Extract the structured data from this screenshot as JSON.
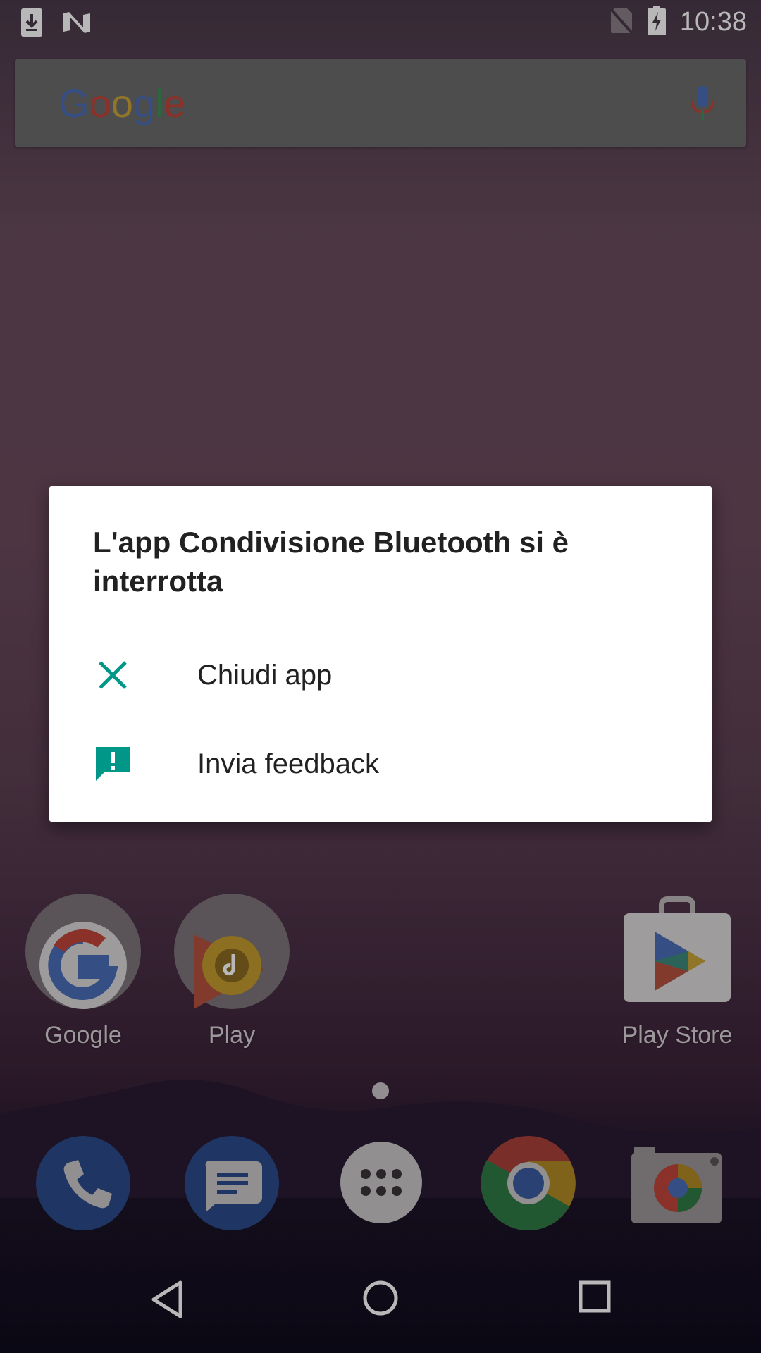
{
  "status_bar": {
    "time": "10:38",
    "left_icons": [
      "download-icon",
      "n-logo-icon"
    ],
    "right_icons": [
      "no-sim-icon",
      "battery-charging-icon"
    ]
  },
  "search": {
    "logo_text": "Google",
    "mic_icon": "mic-icon"
  },
  "apps": [
    {
      "label": "Google",
      "icon": "google-folder-icon"
    },
    {
      "label": "Play",
      "icon": "play-folder-icon"
    },
    {
      "label": "Play Store",
      "icon": "play-store-icon"
    }
  ],
  "dock": [
    {
      "icon": "phone-icon"
    },
    {
      "icon": "messages-icon"
    },
    {
      "icon": "app-drawer-icon"
    },
    {
      "icon": "chrome-icon"
    },
    {
      "icon": "camera-icon"
    }
  ],
  "dialog": {
    "title": "L'app Condivisione Bluetooth si è interrotta",
    "items": [
      {
        "label": "Chiudi app",
        "icon": "close-icon"
      },
      {
        "label": "Invia feedback",
        "icon": "feedback-icon"
      }
    ],
    "accent": "#009688"
  },
  "nav": [
    "back-icon",
    "home-icon",
    "recents-icon"
  ]
}
